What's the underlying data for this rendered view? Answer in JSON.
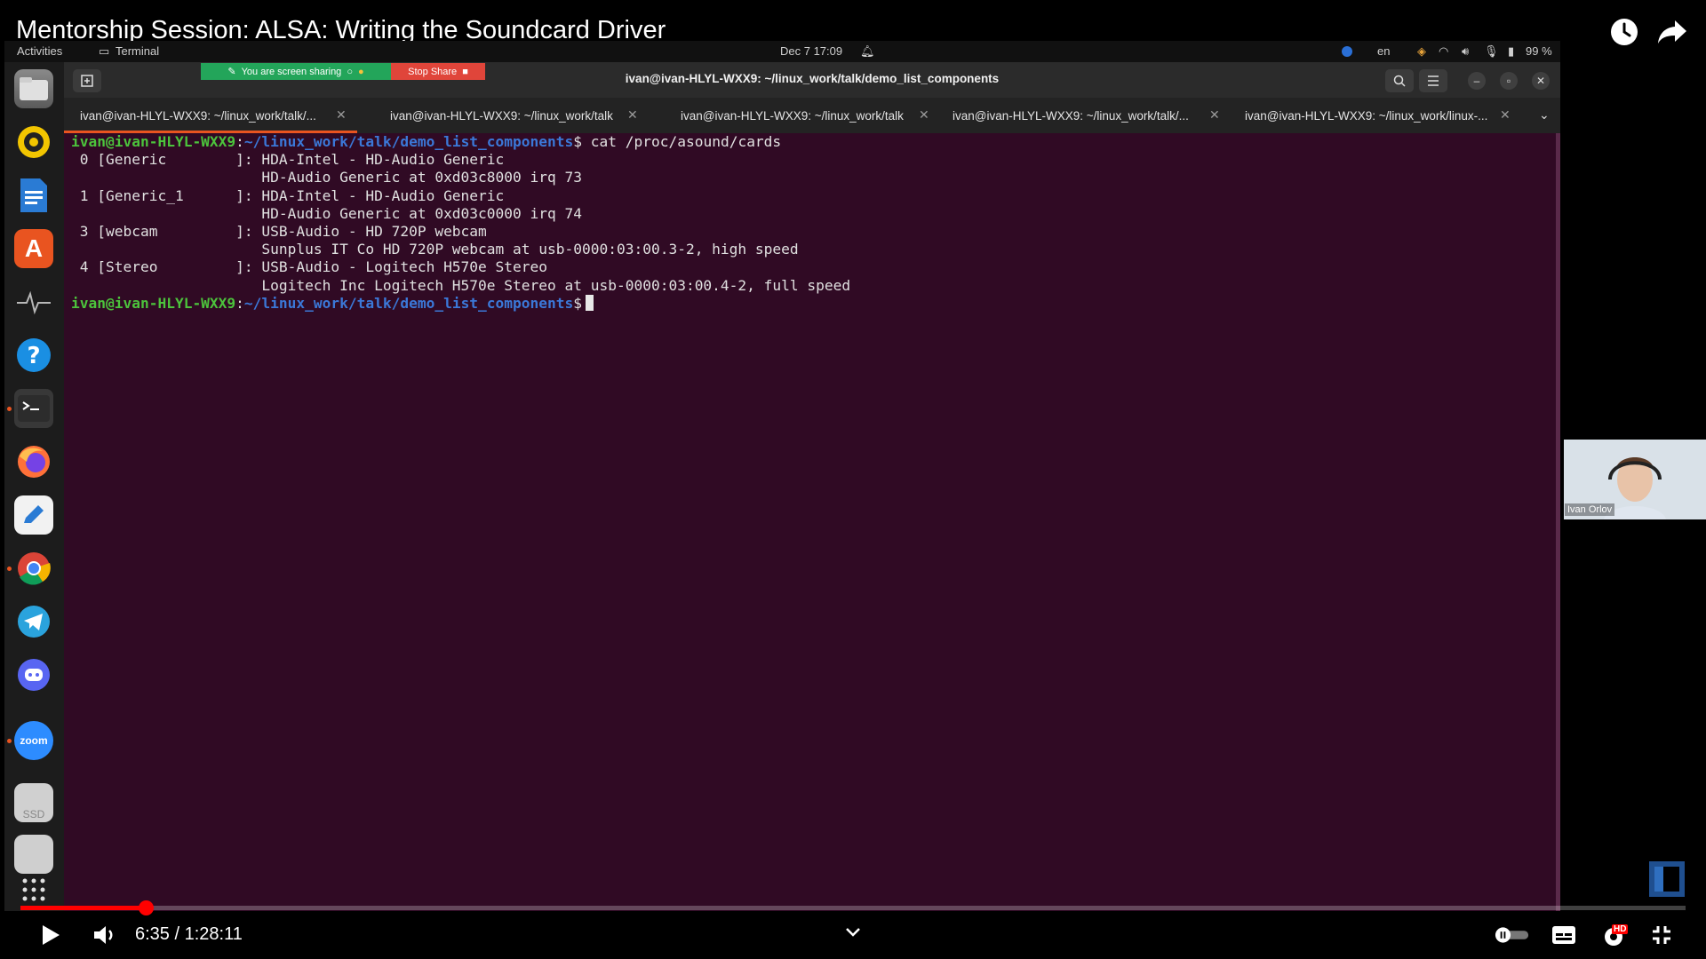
{
  "video": {
    "title": "Mentorship Session: ALSA: Writing the Soundcard Driver",
    "time_display": "6:35 / 1:28:11",
    "progress": 0.075,
    "quality_badge": "HD"
  },
  "gnome": {
    "activities": "Activities",
    "app_name": "Terminal",
    "datetime": "Dec 7  17:09",
    "lang": "en",
    "battery": "99 %"
  },
  "share": {
    "banner": "You are screen sharing",
    "stop": "Stop Share"
  },
  "dock": {
    "zoom_label": "zoom",
    "ssd_label": "SSD"
  },
  "terminal": {
    "window_title": "ivan@ivan-HLYL-WXX9: ~/linux_work/talk/demo_list_components",
    "tabs": [
      {
        "label": "ivan@ivan-HLYL-WXX9: ~/linux_work/talk/..."
      },
      {
        "label": "ivan@ivan-HLYL-WXX9: ~/linux_work/talk"
      },
      {
        "label": "ivan@ivan-HLYL-WXX9: ~/linux_work/talk"
      },
      {
        "label": "ivan@ivan-HLYL-WXX9: ~/linux_work/talk/..."
      },
      {
        "label": "ivan@ivan-HLYL-WXX9: ~/linux_work/linux-..."
      }
    ],
    "prompt_user": "ivan@ivan-HLYL-WXX9",
    "prompt_path": "~/linux_work/talk/demo_list_components",
    "command": "cat /proc/asound/cards",
    "output_lines": [
      " 0 [Generic        ]: HDA-Intel - HD-Audio Generic",
      "                      HD-Audio Generic at 0xd03c8000 irq 73",
      " 1 [Generic_1      ]: HDA-Intel - HD-Audio Generic",
      "                      HD-Audio Generic at 0xd03c0000 irq 74",
      " 3 [webcam         ]: USB-Audio - HD 720P webcam",
      "                      Sunplus IT Co HD 720P webcam at usb-0000:03:00.3-2, high speed",
      " 4 [Stereo         ]: USB-Audio - Logitech H570e Stereo",
      "                      Logitech Inc Logitech H570e Stereo at usb-0000:03:00.4-2, full speed"
    ]
  },
  "webcam": {
    "name": "Ivan Orlov"
  },
  "colors": {
    "terminal_bg": "#300a24",
    "prompt_user": "#4cc33c",
    "prompt_path": "#3b78d8",
    "progress": "#ff0000",
    "accent": "#e95420"
  }
}
